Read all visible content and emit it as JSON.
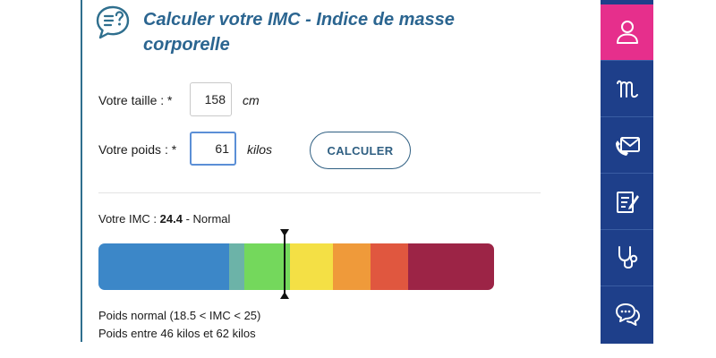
{
  "header": {
    "title": "Calculer votre IMC - Indice de masse corporelle",
    "icon": "chat-question-icon"
  },
  "form": {
    "height": {
      "label": "Votre taille : *",
      "value": "158",
      "unit": "cm"
    },
    "weight": {
      "label": "Votre poids : *",
      "value": "61",
      "unit": "kilos"
    },
    "calculate_label": "CALCULER"
  },
  "result": {
    "prefix": "Votre IMC : ",
    "value": "24.4",
    "suffix": " - Normal",
    "bmi": 24.4
  },
  "gauge": {
    "segments": [
      {
        "color": "#3c87c8"
      },
      {
        "color": "#6cb3a8"
      },
      {
        "color": "#74d85c"
      },
      {
        "color": "#f4e045"
      },
      {
        "color": "#ef9a3a"
      },
      {
        "color": "#e0573f"
      },
      {
        "color": "#9c2446"
      }
    ]
  },
  "info": {
    "line1": "Poids normal (18.5 < IMC < 25)",
    "line2": "Poids entre 46 kilos et 62 kilos"
  },
  "sidebar": {
    "items": [
      {
        "icon": "user-icon",
        "active": true
      },
      {
        "icon": "scale-m-icon",
        "active": false
      },
      {
        "icon": "phone-mail-icon",
        "active": false
      },
      {
        "icon": "document-edit-icon",
        "active": false
      },
      {
        "icon": "stethoscope-icon",
        "active": false
      },
      {
        "icon": "chat-bubbles-icon",
        "active": false
      }
    ],
    "accent": "#e62f8c",
    "background": "#1e3f8a"
  }
}
